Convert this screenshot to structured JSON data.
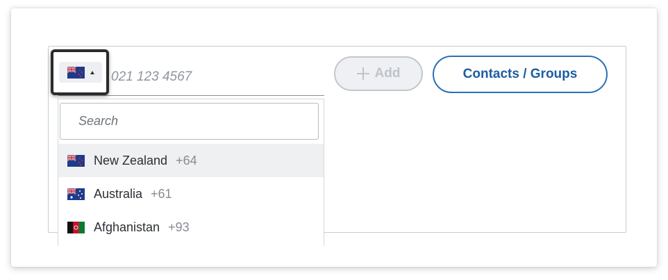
{
  "phone": {
    "placeholder": "021 123 4567",
    "selected_country_flag": "new-zealand-flag-icon"
  },
  "buttons": {
    "add_label": "Add",
    "add_icon": "plus-icon",
    "contacts_label": "Contacts / Groups"
  },
  "dropdown": {
    "search_placeholder": "Search",
    "countries": [
      {
        "name": "New Zealand",
        "code": "+64",
        "flag": "new-zealand-flag-icon",
        "highlighted": true
      },
      {
        "name": "Australia",
        "code": "+61",
        "flag": "australia-flag-icon",
        "highlighted": false
      },
      {
        "name": "Afghanistan",
        "code": "+93",
        "flag": "afghanistan-flag-icon",
        "highlighted": false
      }
    ]
  },
  "colors": {
    "accent": "#2a6fb5",
    "disabled_button": "#eef0f3",
    "highlight_row": "#eff0f2",
    "focus_ring": "#2b2b2b"
  }
}
